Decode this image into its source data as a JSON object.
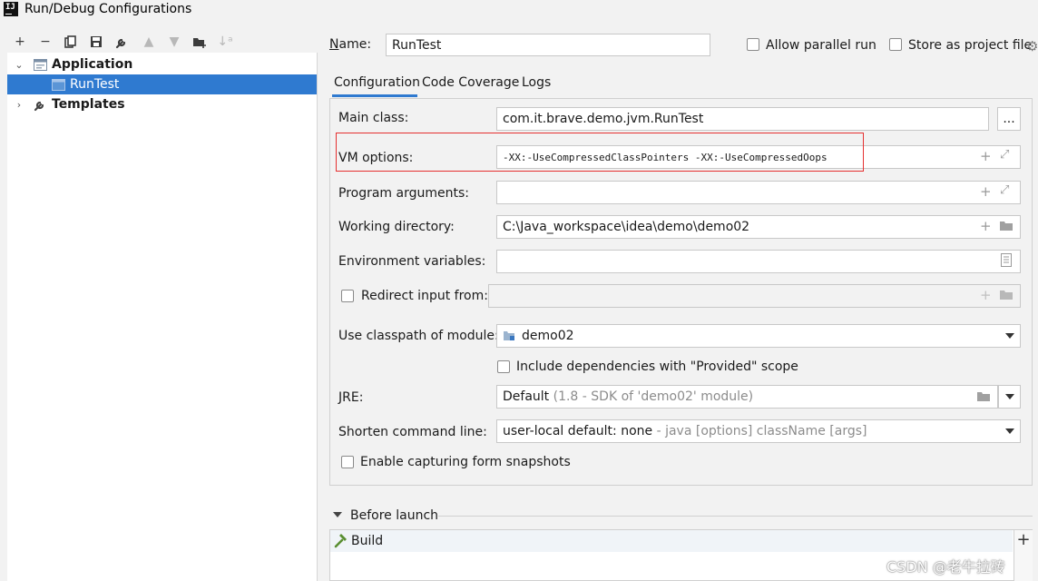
{
  "window": {
    "title": "Run/Debug Configurations",
    "logo_text": "IJ"
  },
  "toolbar": [
    {
      "name": "add-icon",
      "glyph": "+",
      "enabled": true
    },
    {
      "name": "remove-icon",
      "glyph": "−",
      "enabled": true
    },
    {
      "name": "copy-icon",
      "glyph": "⧉",
      "enabled": true
    },
    {
      "name": "save-icon",
      "glyph": "💾",
      "enabled": true
    },
    {
      "name": "wrench-icon",
      "glyph": "🔧",
      "enabled": true
    },
    {
      "name": "move-up-icon",
      "glyph": "▲",
      "enabled": false
    },
    {
      "name": "move-down-icon",
      "glyph": "▼",
      "enabled": false
    },
    {
      "name": "new-folder-icon",
      "glyph": "📁",
      "enabled": true
    },
    {
      "name": "sort-icon",
      "glyph": "↓",
      "enabled": false
    }
  ],
  "tree": {
    "application_label": "Application",
    "runtest_label": "RunTest",
    "templates_label": "Templates"
  },
  "header": {
    "name_label": "Name:",
    "name_value": "RunTest",
    "allow_parallel_label": "Allow parallel run",
    "store_as_project_label": "Store as project file"
  },
  "tabs": [
    "Configuration",
    "Code Coverage",
    "Logs"
  ],
  "config": {
    "main_class_label": "Main class:",
    "main_class_value": "com.it.brave.demo.jvm.RunTest",
    "browse_label": "...",
    "vm_options_label": "VM options:",
    "vm_options_value": "-XX:-UseCompressedClassPointers -XX:-UseCompressedOops",
    "program_args_label": "Program arguments:",
    "program_args_value": "",
    "working_dir_label": "Working directory:",
    "working_dir_value": "C:\\Java_workspace\\idea\\demo\\demo02",
    "env_vars_label": "Environment variables:",
    "env_vars_value": "",
    "redirect_input_label": "Redirect input from:",
    "classpath_label": "Use classpath of module:",
    "classpath_value": "demo02",
    "include_deps_label": "Include dependencies with \"Provided\" scope",
    "jre_label": "JRE:",
    "jre_value": "Default",
    "jre_hint": "(1.8 - SDK of 'demo02' module)",
    "shorten_label": "Shorten command line:",
    "shorten_value": "user-local default: none",
    "shorten_hint": "- java [options] className [args]",
    "snapshots_label": "Enable capturing form snapshots"
  },
  "before_launch": {
    "title": "Before launch",
    "items": [
      "Build"
    ],
    "add_glyph": "+"
  },
  "watermark": "CSDN @老牛拉砖",
  "colors": {
    "accent": "#2f7ad0",
    "highlight_border": "#e53030"
  }
}
